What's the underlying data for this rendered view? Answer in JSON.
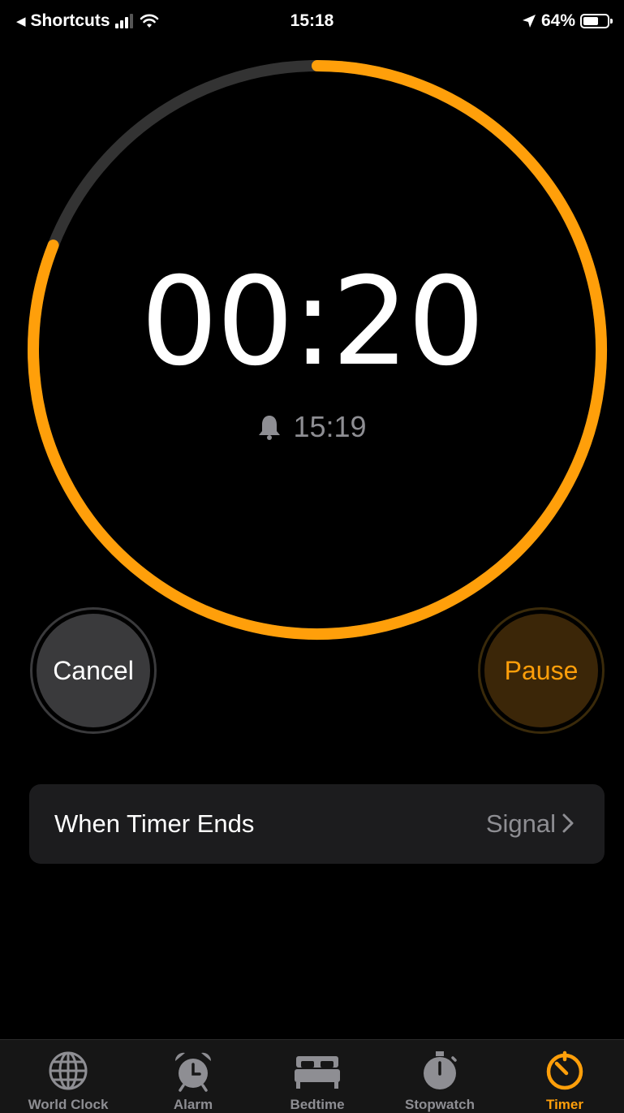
{
  "status_bar": {
    "back_label": "Shortcuts",
    "time": "15:18",
    "battery": "64%",
    "battery_level": 0.64
  },
  "timer": {
    "remaining": "00:20",
    "end_time": "15:19",
    "progress_remaining": 0.81,
    "ring_color": "#ff9f0a",
    "track_color": "#333333"
  },
  "buttons": {
    "cancel_label": "Cancel",
    "pause_label": "Pause"
  },
  "when_timer_ends": {
    "label": "When Timer Ends",
    "value": "Signal"
  },
  "tabs": [
    {
      "label": "World Clock",
      "icon": "globe-icon",
      "active": false
    },
    {
      "label": "Alarm",
      "icon": "alarm-clock-icon",
      "active": false
    },
    {
      "label": "Bedtime",
      "icon": "bed-icon",
      "active": false
    },
    {
      "label": "Stopwatch",
      "icon": "stopwatch-icon",
      "active": false
    },
    {
      "label": "Timer",
      "icon": "timer-icon",
      "active": true
    }
  ],
  "colors": {
    "accent": "#ff9f0a",
    "inactive": "#8e8e93"
  }
}
